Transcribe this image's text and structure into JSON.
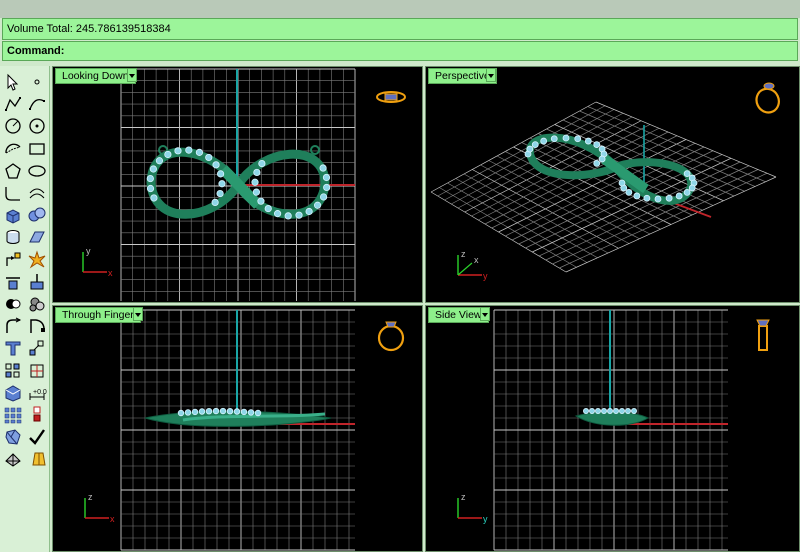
{
  "history": {
    "text": "Volume Total: 245.786139518384"
  },
  "command": {
    "label": "Command:"
  },
  "toolbar": {
    "icons": [
      "select-arrow-icon",
      "point-icon",
      "polyline-icon",
      "curve-icon",
      "circle-icon",
      "circle-center-icon",
      "arc-icon",
      "rectangle-icon",
      "polygon-icon",
      "ellipse-icon",
      "fillet-curve-icon",
      "offset-curve-icon",
      "box-icon",
      "sphere-icon",
      "cylinder-icon",
      "surface-icon",
      "transform-icon",
      "explode-icon",
      "trim-icon",
      "split-icon",
      "boolean-union-icon",
      "boolean-difference-icon",
      "fillet-edge-icon",
      "chamfer-icon",
      "text-icon",
      "point-snap-icon",
      "array-icon",
      "gumball-icon",
      "render-icon",
      "dimension-icon",
      "grid-array-icon",
      "layer-icon",
      "gem-icon",
      "check-icon",
      "mesh-icon",
      "light-icon"
    ]
  },
  "viewports": {
    "top_left": {
      "title": "Looking Down",
      "icon": "ring-top-view-icon"
    },
    "top_right": {
      "title": "Perspective",
      "icon": "ring-perspective-icon"
    },
    "bottom_left": {
      "title": "Through Finger",
      "icon": "ring-front-view-icon"
    },
    "bottom_right": {
      "title": "Side View",
      "icon": "ring-side-view-icon"
    }
  },
  "axis_labels": {
    "top_left": {
      "a": "y",
      "b": "x"
    },
    "top_right": {
      "a": "z",
      "b": "y",
      "c": "x"
    },
    "bottom_left": {
      "a": "z",
      "b": "x"
    },
    "bottom_right": {
      "a": "z",
      "b": "y"
    }
  },
  "colors": {
    "grid": "#7d7d7d",
    "grid_major": "#c8c8c8",
    "axis_x": "#c0252b",
    "axis_y": "#1aa6a6",
    "model": "#1f7f5b",
    "gem": "#8fd6e8",
    "ring_icon": "#f0a010"
  }
}
